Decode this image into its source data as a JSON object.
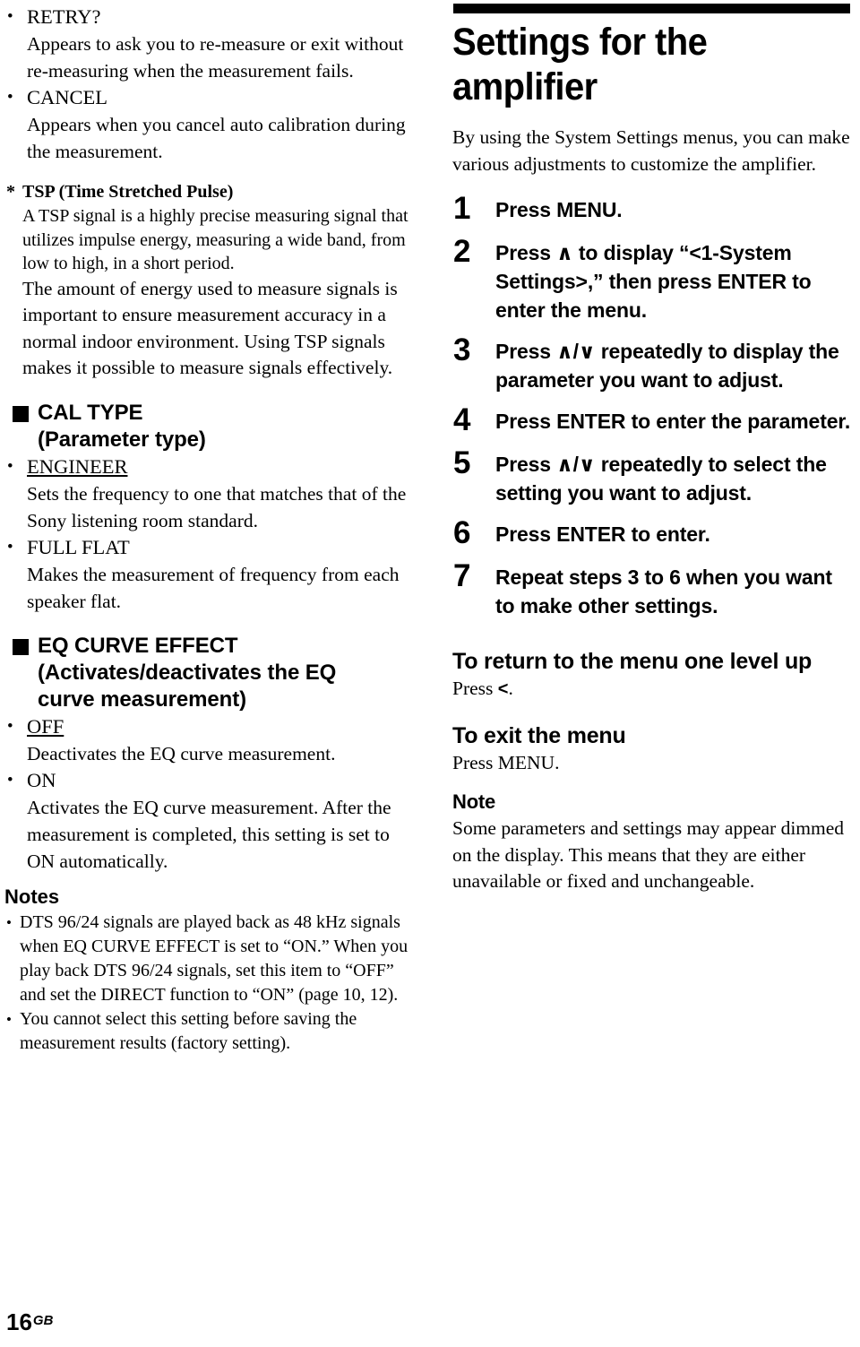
{
  "left_column": {
    "display_messages": [
      {
        "bullet": "•",
        "term": "RETRY?",
        "description": "Appears to ask you to re-measure or exit without re-measuring when the measurement fails."
      },
      {
        "bullet": "•",
        "term": "CANCEL",
        "description": "Appears when you cancel auto calibration during the measurement."
      }
    ],
    "footnote": {
      "marker": "*",
      "heading": "TSP (Time Stretched Pulse)",
      "paragraph_1": "A TSP signal is a highly precise measuring signal that utilizes impulse energy, measuring a wide band, from low to high, in a short period.",
      "paragraph_2": "The amount of energy used to measure signals is important to ensure measurement accuracy in a normal indoor environment. Using TSP signals makes it possible to measure signals effectively."
    },
    "sections": [
      {
        "bullet_icon": "black-square",
        "title_line_1": "CAL TYPE",
        "title_line_2": "(Parameter type)",
        "options": [
          {
            "bullet": "•",
            "term": "ENGINEER",
            "underlined": true,
            "description": "Sets the frequency to one that matches that of the Sony listening room standard."
          },
          {
            "bullet": "•",
            "term": "FULL FLAT",
            "underlined": false,
            "description": "Makes the measurement of frequency from each speaker flat."
          }
        ]
      },
      {
        "bullet_icon": "black-square",
        "title_line_1": "EQ CURVE EFFECT",
        "title_line_2": "(Activates/deactivates the EQ",
        "title_line_3": "curve measurement)",
        "options": [
          {
            "bullet": "•",
            "term": "OFF",
            "underlined": true,
            "description": "Deactivates the EQ curve measurement."
          },
          {
            "bullet": "•",
            "term": "ON",
            "underlined": false,
            "description": "Activates the EQ curve measurement. After the measurement is completed, this setting is set to ON automatically."
          }
        ]
      }
    ],
    "notes": {
      "heading": "Notes",
      "items": [
        "DTS 96/24 signals are played back as 48 kHz signals when EQ CURVE EFFECT is set to “ON.” When you play back DTS 96/24 signals, set this item to “OFF” and set the DIRECT function to “ON” (page 10, 12).",
        "You cannot select this setting before saving the measurement results (factory setting)."
      ]
    }
  },
  "right_column": {
    "title": "Settings for the amplifier",
    "intro": "By using the System Settings menus, you can make various adjustments to customize the amplifier.",
    "steps": [
      {
        "number": "1",
        "text": "Press MENU."
      },
      {
        "number": "2",
        "text": "Press ∧ to display “<1-System Settings>,” then press ENTER to enter the menu."
      },
      {
        "number": "3",
        "text": "Press ∧/∨ repeatedly to display the parameter you want to adjust."
      },
      {
        "number": "4",
        "text": "Press ENTER to enter the parameter."
      },
      {
        "number": "5",
        "text": "Press ∧/∨ repeatedly to select the setting you want to adjust."
      },
      {
        "number": "6",
        "text": "Press ENTER to enter."
      },
      {
        "number": "7",
        "text": "Repeat steps 3 to 6 when you want to make other settings."
      }
    ],
    "return_section": {
      "heading": "To return to the menu one level up",
      "body_prefix": "Press ",
      "body_key": "<",
      "body_suffix": "."
    },
    "exit_section": {
      "heading": "To exit the menu",
      "body": "Press MENU."
    },
    "note_section": {
      "heading": "Note",
      "body": "Some parameters and settings may appear dimmed on the display. This means that they are either unavailable or fixed and unchangeable."
    }
  },
  "footer": {
    "page_number": "16",
    "region_code": "GB"
  }
}
